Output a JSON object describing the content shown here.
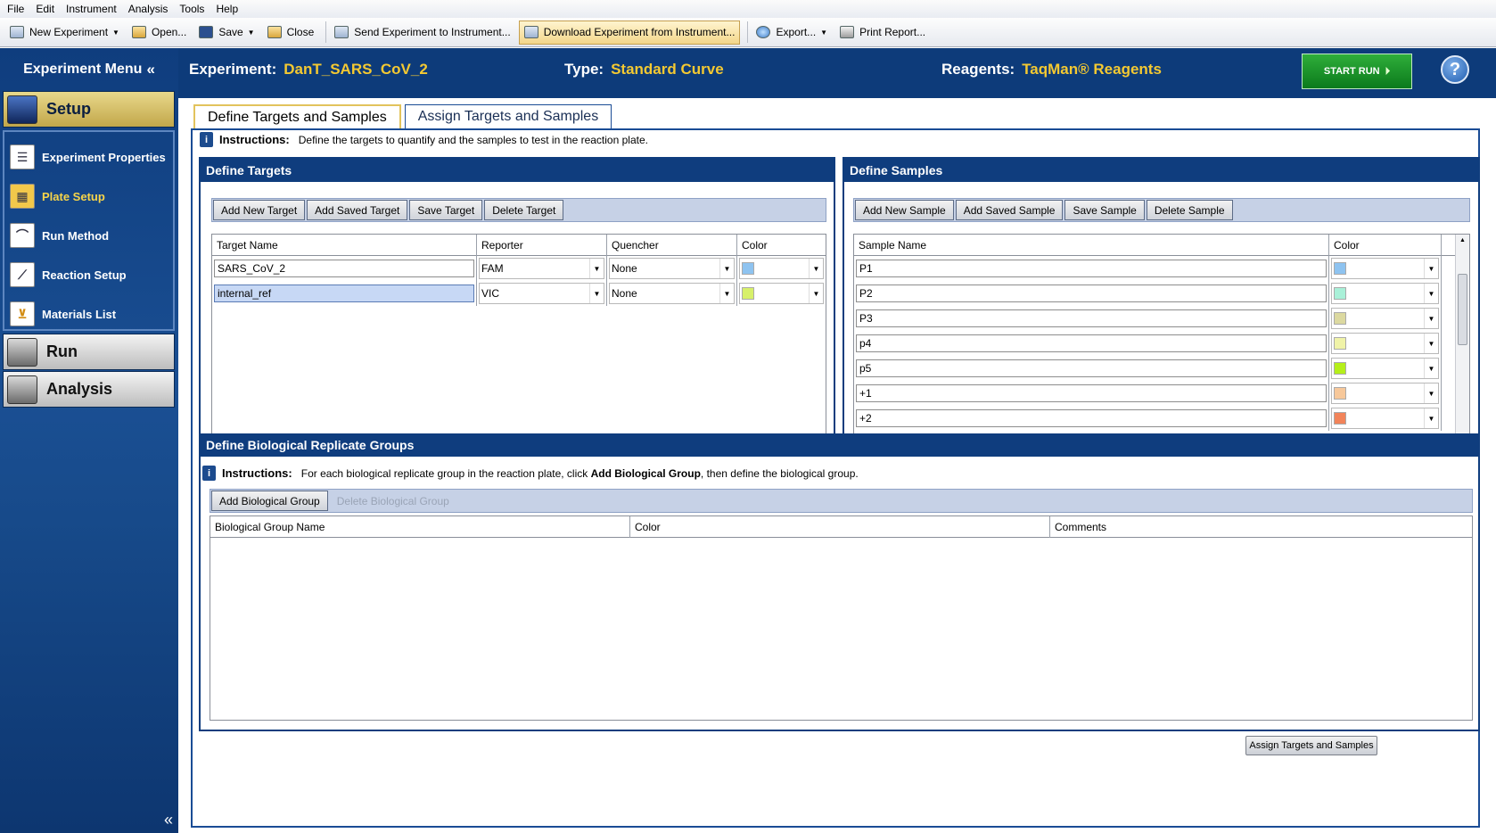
{
  "menubar": [
    "File",
    "Edit",
    "Instrument",
    "Analysis",
    "Tools",
    "Help"
  ],
  "toolbar": {
    "new_experiment": "New Experiment",
    "open": "Open...",
    "save": "Save",
    "close": "Close",
    "send": "Send Experiment to Instrument...",
    "download": "Download Experiment from Instrument...",
    "export": "Export...",
    "print": "Print Report..."
  },
  "sidebar": {
    "title": "Experiment Menu",
    "collapse": "«",
    "setup": "Setup",
    "items": [
      {
        "label": "Experiment Properties",
        "icon": "document-icon"
      },
      {
        "label": "Plate Setup",
        "icon": "plate-icon",
        "active": true
      },
      {
        "label": "Run Method",
        "icon": "thermal-profile-icon"
      },
      {
        "label": "Reaction Setup",
        "icon": "pipette-icon"
      },
      {
        "label": "Materials List",
        "icon": "cart-icon"
      }
    ],
    "run": "Run",
    "analysis": "Analysis"
  },
  "header": {
    "experiment_label": "Experiment:",
    "experiment_value": "DanT_SARS_CoV_2",
    "type_label": "Type:",
    "type_value": "Standard Curve",
    "reagents_label": "Reagents:",
    "reagents_value": "TaqMan® Reagents",
    "start_run": "START RUN",
    "help": "?"
  },
  "tabs": [
    "Define Targets and Samples",
    "Assign Targets and Samples"
  ],
  "instructions": {
    "label": "Instructions:",
    "text": "Define the targets to quantify and the samples to test in the reaction plate."
  },
  "targets": {
    "title": "Define Targets",
    "buttons": [
      "Add New Target",
      "Add Saved Target",
      "Save Target",
      "Delete Target"
    ],
    "columns": [
      "Target Name",
      "Reporter",
      "Quencher",
      "Color"
    ],
    "rows": [
      {
        "name": "SARS_CoV_2",
        "reporter": "FAM",
        "quencher": "None",
        "color": "#8ec3f0"
      },
      {
        "name": "internal_ref",
        "reporter": "VIC",
        "quencher": "None",
        "color": "#d7f06a"
      }
    ]
  },
  "samples": {
    "title": "Define Samples",
    "buttons": [
      "Add New Sample",
      "Add Saved Sample",
      "Save Sample",
      "Delete Sample"
    ],
    "columns": [
      "Sample Name",
      "Color"
    ],
    "rows": [
      {
        "name": "P1",
        "color": "#8ec3f0"
      },
      {
        "name": "P2",
        "color": "#a9f0d8"
      },
      {
        "name": "P3",
        "color": "#dcd9a0"
      },
      {
        "name": "p4",
        "color": "#f0f3a8"
      },
      {
        "name": "p5",
        "color": "#b5ef1a"
      },
      {
        "name": "+1",
        "color": "#f7c89a"
      },
      {
        "name": "+2",
        "color": "#f2845a"
      }
    ]
  },
  "bio": {
    "title": "Define Biological Replicate Groups",
    "instr_label": "Instructions:",
    "instr_pre": "For each biological replicate group in the reaction plate, click ",
    "instr_bold": "Add Biological Group",
    "instr_post": ", then define the biological group.",
    "buttons": [
      "Add Biological Group",
      "Delete Biological Group"
    ],
    "columns": [
      "Biological Group Name",
      "Color",
      "Comments"
    ]
  },
  "assign_button": "Assign Targets and Samples"
}
